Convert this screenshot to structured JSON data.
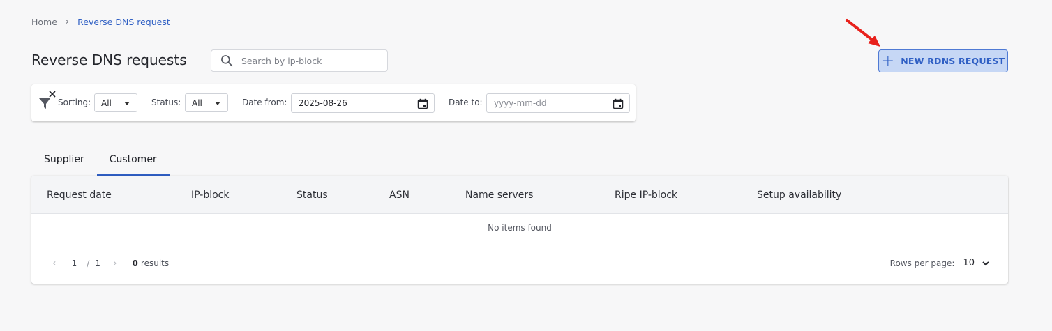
{
  "breadcrumb": {
    "home": "Home",
    "separator": "›",
    "current": "Reverse DNS request"
  },
  "page": {
    "title": "Reverse DNS requests"
  },
  "search": {
    "placeholder": "Search by ip-block",
    "icon": "search-icon"
  },
  "actions": {
    "new_button_label": "NEW RDNS REQUEST",
    "new_button_icon": "plus-icon"
  },
  "filters": {
    "sorting_label": "Sorting:",
    "sorting_value": "All",
    "status_label": "Status:",
    "status_value": "All",
    "date_from_label": "Date from:",
    "date_from_value": "2025-08-26",
    "date_to_label": "Date to:",
    "date_to_placeholder": "yyyy-mm-dd"
  },
  "tabs": [
    {
      "label": "Supplier",
      "active": false
    },
    {
      "label": "Customer",
      "active": true
    }
  ],
  "table": {
    "columns": [
      "Request date",
      "IP-block",
      "Status",
      "ASN",
      "Name servers",
      "Ripe IP-block",
      "Setup availability"
    ],
    "empty_message": "No items found"
  },
  "pagination": {
    "prev": "‹",
    "current_page": "1",
    "separator": "/",
    "total_pages": "1",
    "next": "›",
    "results_count": "0",
    "results_label": "results",
    "rows_per_page_label": "Rows per page:",
    "rows_per_page_value": "10"
  },
  "colors": {
    "accent": "#2f5fc4",
    "button_bg": "#c6d7f5",
    "annotation_arrow": "#e8211c"
  }
}
